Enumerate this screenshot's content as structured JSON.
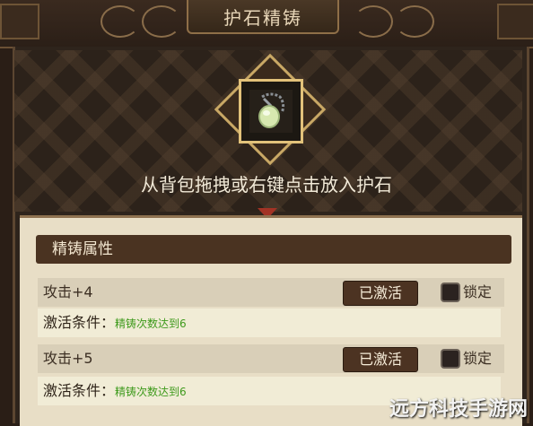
{
  "window": {
    "title": "护石精铸"
  },
  "slot": {
    "hint": "从背包拖拽或右键点击放入护石",
    "item_icon": "amulet-icon"
  },
  "attributes": {
    "header": "精铸属性",
    "rows": [
      {
        "name": "攻击+4",
        "status": "已激活",
        "lock_label": "锁定",
        "condition_label": "激活条件：",
        "condition_value": "精铸次数达到6"
      },
      {
        "name": "攻击+5",
        "status": "已激活",
        "lock_label": "锁定",
        "condition_label": "激活条件：",
        "condition_value": "精铸次数达到6"
      }
    ]
  },
  "watermark": "远方科技手游网",
  "colors": {
    "accent_gold": "#e2c27a",
    "condition_green": "#3e9a1c",
    "button_brown": "#4c3322"
  }
}
